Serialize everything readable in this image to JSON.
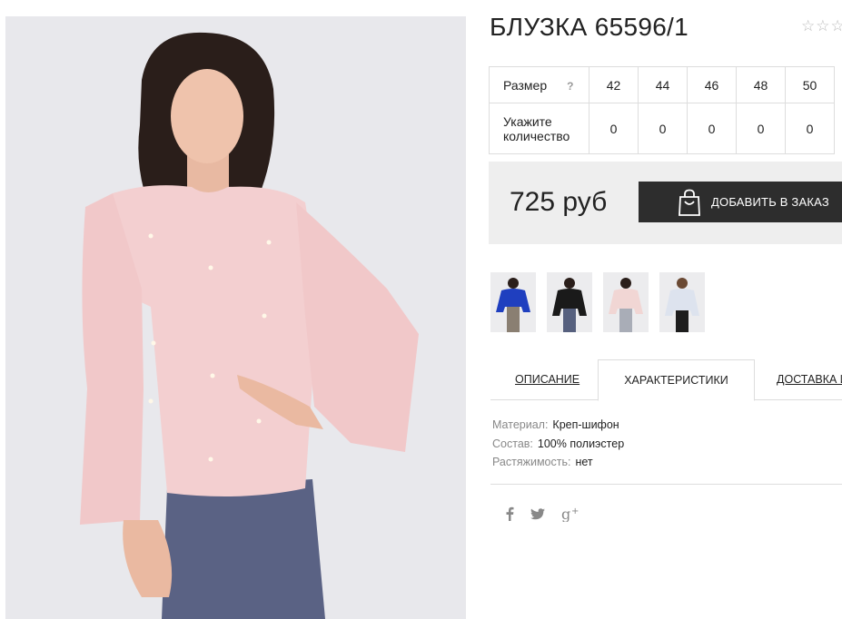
{
  "product": {
    "title": "БЛУЗКА 65596/1",
    "rating_stars": "☆☆☆",
    "image_alt": "model-photo"
  },
  "sizes": {
    "label": "Размер",
    "help": "?",
    "values": [
      "42",
      "44",
      "46",
      "48",
      "50"
    ],
    "quantity_label_line1": "Укажите",
    "quantity_label_line2": "количество",
    "quantities": [
      "0",
      "0",
      "0",
      "0",
      "0"
    ]
  },
  "purchase": {
    "price": "725 руб",
    "add_button": "ДОБАВИТЬ В ЗАКАЗ"
  },
  "thumbnails": [
    {
      "name": "thumb-blue",
      "color": "#1f3fbf"
    },
    {
      "name": "thumb-black",
      "color": "#1a1a1a"
    },
    {
      "name": "thumb-pink",
      "color": "#f1d6d4"
    },
    {
      "name": "thumb-white",
      "color": "#dde3ee"
    }
  ],
  "tabs": {
    "description": "ОПИСАНИЕ",
    "characteristics": "ХАРАКТЕРИСТИКИ",
    "delivery": "ДОСТАВКА И"
  },
  "specs": [
    {
      "key": "Материал:",
      "value": "Креп-шифон"
    },
    {
      "key": "Состав:",
      "value": "100% полиэстер"
    },
    {
      "key": "Растяжимость:",
      "value": "нет"
    }
  ],
  "social": {
    "facebook": "f",
    "twitter": "twitter",
    "google": "g+"
  },
  "colors": {
    "blouse": "#f3cfd0",
    "pants": "#5a6284",
    "button_bg": "#2d2d2d",
    "price_bg": "#eeeeee"
  }
}
